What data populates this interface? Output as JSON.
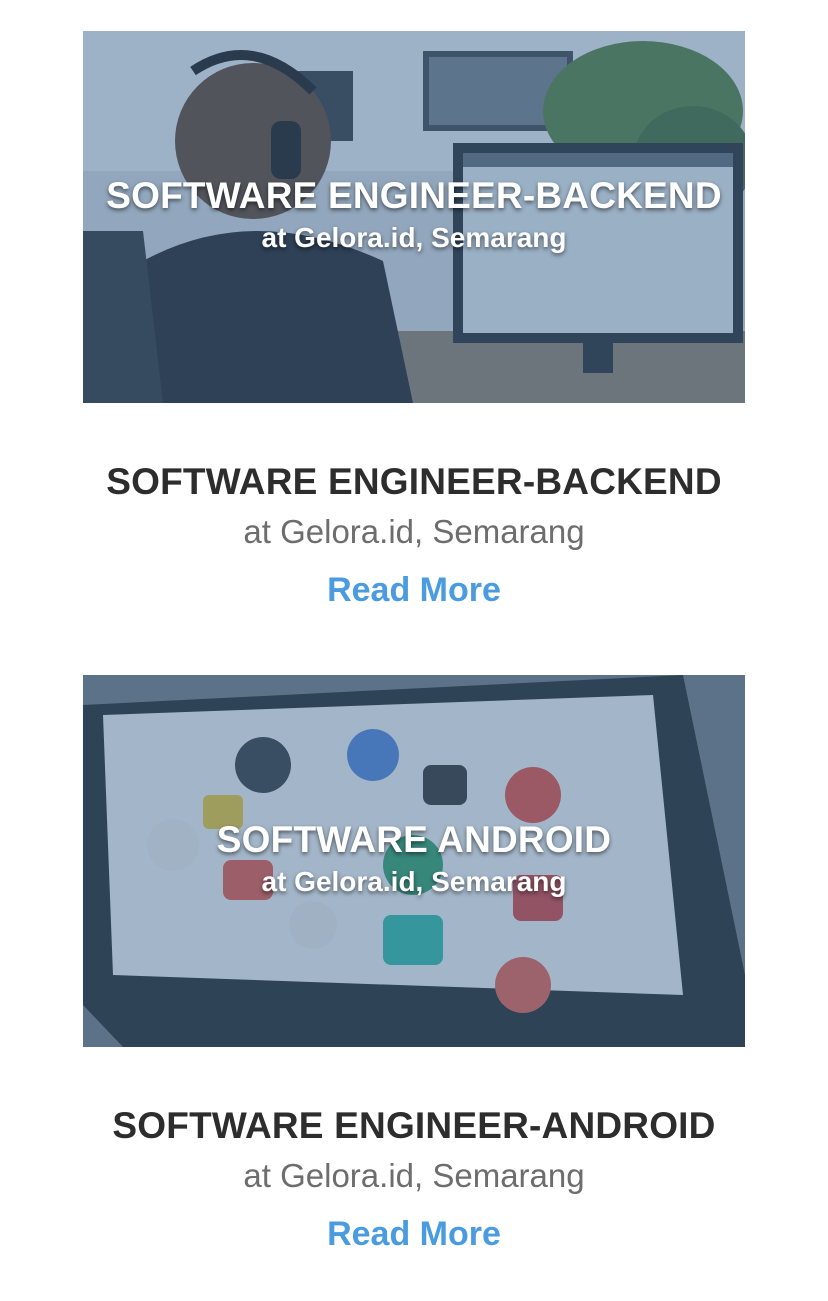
{
  "jobs": [
    {
      "banner_title": "SOFTWARE ENGINEER-BACKEND",
      "banner_subtitle": "at Gelora.id, Semarang",
      "title": "SOFTWARE ENGINEER-BACKEND",
      "subtitle": "at Gelora.id, Semarang",
      "read_more": "Read More"
    },
    {
      "banner_title": "SOFTWARE ANDROID",
      "banner_subtitle": "at Gelora.id, Semarang",
      "title": "SOFTWARE ENGINEER-ANDROID",
      "subtitle": "at Gelora.id, Semarang",
      "read_more": "Read More"
    }
  ],
  "colors": {
    "title": "#2d2d2d",
    "subtitle": "#6d6d6d",
    "link": "#4a9be0",
    "overlay": "#486e96"
  }
}
